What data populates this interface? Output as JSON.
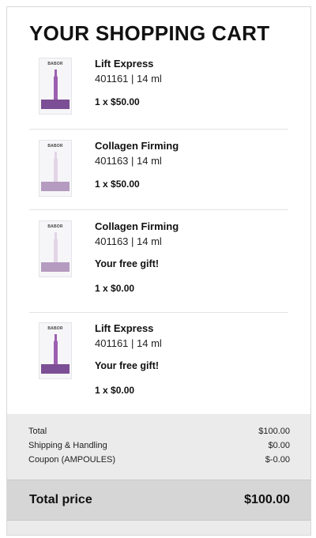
{
  "cart": {
    "title": "YOUR SHOPPING CART",
    "items": [
      {
        "name": "Lift Express",
        "meta": "401161 | 14 ml",
        "gift": "",
        "price": "1 x $50.00",
        "thumb_brand": "BABOR",
        "vial_color": "#9b5fb0",
        "band_color": "#7c4e95"
      },
      {
        "name": "Collagen Firming",
        "meta": "401163 | 14 ml",
        "gift": "",
        "price": "1 x $50.00",
        "thumb_brand": "BABOR",
        "vial_color": "#e3d4e6",
        "band_color": "#b59bc0"
      },
      {
        "name": "Collagen Firming",
        "meta": "401163 | 14 ml",
        "gift": "Your free gift!",
        "price": "1 x $0.00",
        "thumb_brand": "BABOR",
        "vial_color": "#e3d4e6",
        "band_color": "#b59bc0"
      },
      {
        "name": "Lift Express",
        "meta": "401161 | 14 ml",
        "gift": "Your free gift!",
        "price": "1 x $0.00",
        "thumb_brand": "BABOR",
        "vial_color": "#9b5fb0",
        "band_color": "#7c4e95"
      }
    ]
  },
  "summary": {
    "total_label": "Total",
    "total_value": "$100.00",
    "shipping_label": "Shipping & Handling",
    "shipping_value": "$0.00",
    "coupon_label": "Coupon (AMPOULES)",
    "coupon_value": "$-0.00"
  },
  "grand_total": {
    "label": "Total price",
    "value": "$100.00"
  }
}
